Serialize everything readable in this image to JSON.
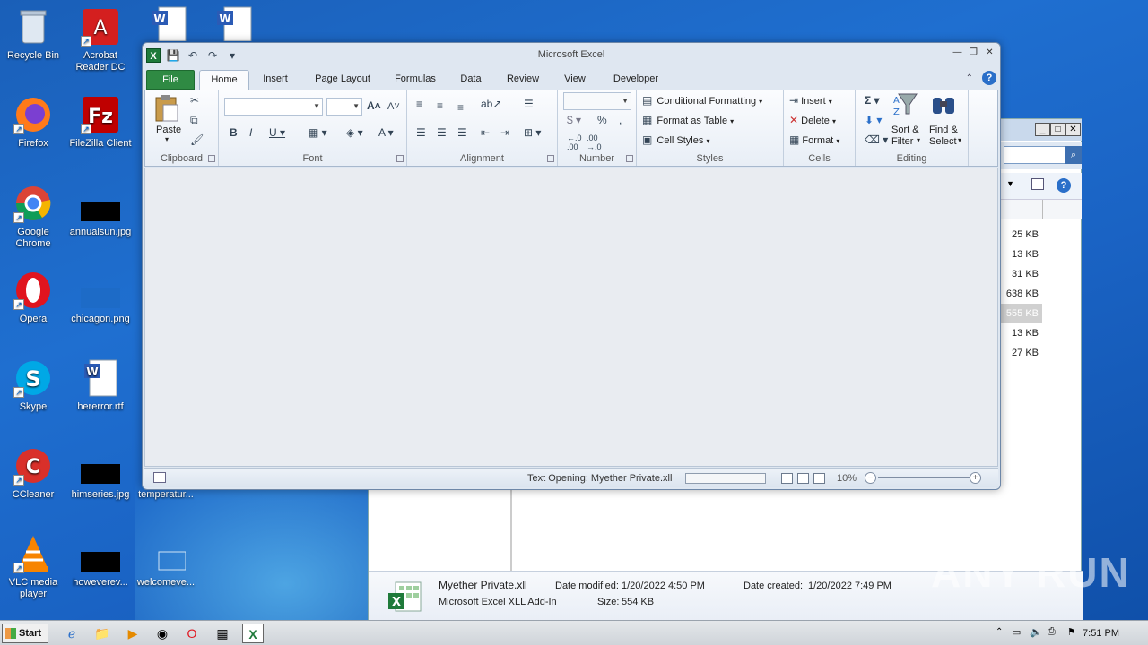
{
  "desktop": {
    "icons": [
      {
        "label": "Recycle Bin"
      },
      {
        "label": "Acrobat\nReader DC"
      },
      {
        "label": "Firefox"
      },
      {
        "label": "FileZilla Client"
      },
      {
        "label": "Google\nChrome"
      },
      {
        "label": "annualsun.jpg"
      },
      {
        "label": "Opera"
      },
      {
        "label": "chicagon.png"
      },
      {
        "label": "Skype"
      },
      {
        "label": "hererror.rtf"
      },
      {
        "label": "CCleaner"
      },
      {
        "label": "himseries.jpg"
      },
      {
        "label": "temperatur..."
      },
      {
        "label": "VLC media\nplayer"
      },
      {
        "label": "howeverev..."
      },
      {
        "label": "welcomeve..."
      }
    ]
  },
  "explorer": {
    "sizes": [
      "25 KB",
      "13 KB",
      "31 KB",
      "638 KB",
      "555 KB",
      "13 KB",
      "27 KB"
    ],
    "details": {
      "file_name": "Myether Private.xll",
      "file_type": "Microsoft Excel XLL Add-In",
      "date_modified_label": "Date modified:",
      "date_modified": "1/20/2022 4:50 PM",
      "date_created_label": "Date created:",
      "date_created": "1/20/2022 7:49 PM",
      "size_label": "Size:",
      "size": "554 KB"
    }
  },
  "excel": {
    "title": "Microsoft Excel",
    "tabs": [
      "File",
      "Home",
      "Insert",
      "Page Layout",
      "Formulas",
      "Data",
      "Review",
      "View",
      "Developer"
    ],
    "groups": {
      "clipboard": {
        "label": "Clipboard",
        "paste": "Paste"
      },
      "font": {
        "label": "Font"
      },
      "alignment": {
        "label": "Alignment"
      },
      "number": {
        "label": "Number"
      },
      "styles": {
        "label": "Styles",
        "conditional": "Conditional Formatting",
        "format_table": "Format as Table",
        "cell_styles": "Cell Styles"
      },
      "cells": {
        "label": "Cells",
        "insert": "Insert",
        "delete": "Delete",
        "format": "Format"
      },
      "editing": {
        "label": "Editing",
        "sort": "Sort &",
        "sort2": "Filter",
        "find": "Find &",
        "find2": "Select"
      }
    },
    "status": {
      "text": "Text Opening: Myether Private.xll",
      "zoom": "10%",
      "progress": 0
    }
  },
  "taskbar": {
    "start": "Start",
    "clock": "7:51 PM"
  },
  "watermark": "ANY RUN"
}
